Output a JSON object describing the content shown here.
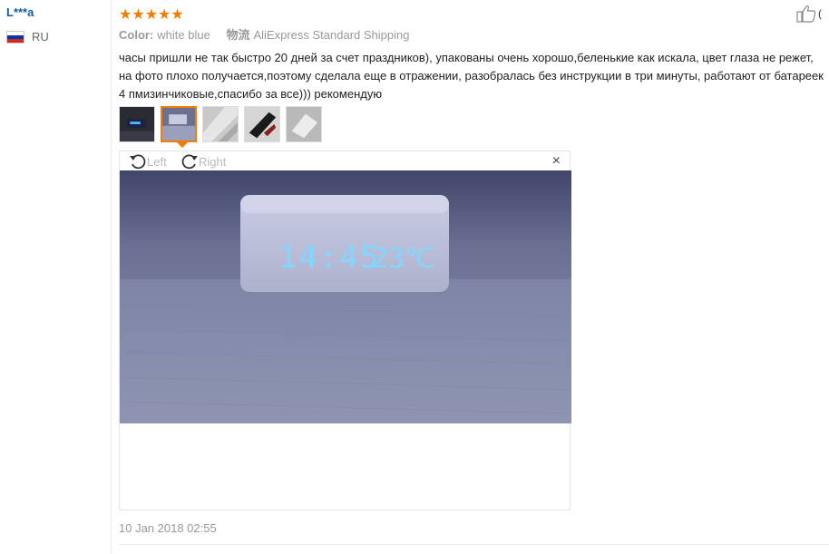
{
  "user": {
    "name": "L***a",
    "country": "RU",
    "flag_colors": [
      "#ffffff",
      "#0039a6",
      "#d52b1e"
    ]
  },
  "review": {
    "stars": 5,
    "star_glyphs": "★★★★★",
    "color_label": "Color:",
    "color_value": "white blue",
    "shipping_label": "物流",
    "shipping_value": "AliExpress Standard Shipping",
    "helpful_text": "(",
    "text": "часы пришли не так быстро 20 дней за счет праздников), упакованы очень хорошо,беленькие как искала, цвет глаза не режет, на фото плохо получается,поэтому сделала еще в отражении, разобралась без инструкции в три минуты, работают от батареек 4 пмизинчиковые,спасибо за все))) рекомендую",
    "date": "10 Jan 2018 02:55"
  },
  "thumbnails": [
    {
      "name": "photo-1",
      "active": false
    },
    {
      "name": "photo-2",
      "active": true
    },
    {
      "name": "photo-3",
      "active": false
    },
    {
      "name": "photo-4",
      "active": false
    },
    {
      "name": "photo-5",
      "active": false
    }
  ],
  "viewer": {
    "rotate_left_label": "Left",
    "rotate_right_label": "Right",
    "close_label": "×",
    "clock_time": "14:45",
    "clock_temp": "23℃"
  },
  "colors": {
    "accent": "#f57c00",
    "username": "#0d5fa8",
    "clock_digits": "#7fd8ff"
  }
}
